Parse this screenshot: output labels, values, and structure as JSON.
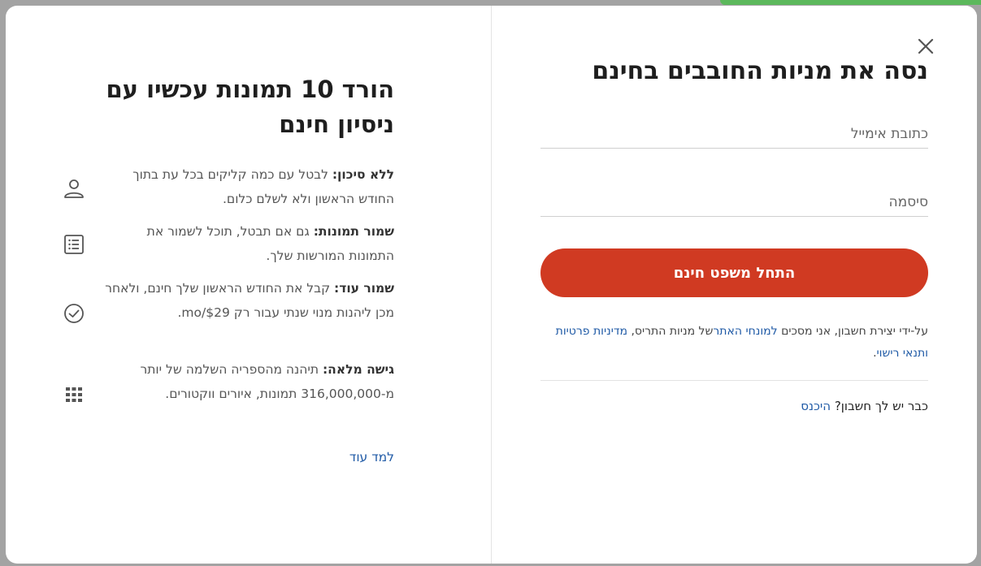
{
  "form": {
    "title": "נסה את מניות החובבים בחינם",
    "email_placeholder": "כתובת אימייל",
    "password_placeholder": "סיסמה",
    "submit_label": "התחל משפט חינם",
    "terms_prefix": "על-ידי יצירת חשבון, אני מסכים ",
    "terms_link": "למונחי האתר",
    "terms_middle": "של מניות התריס, ",
    "privacy_link": "מדיניות פרטיות ותנאי רישוי",
    "terms_suffix": ".",
    "signin_prompt": "כבר יש לך חשבון? ",
    "signin_link": "היכנס"
  },
  "info": {
    "title": "הורד 10 תמונות עכשיו עם ניסיון חינם",
    "benefits": [
      {
        "bold": "ללא סיכון:",
        "text": " לבטל עם כמה קליקים בכל עת בתוך החודש הראשון ולא לשלם כלום.",
        "icon": "user-icon"
      },
      {
        "bold": "שמור תמונות:",
        "text": " גם אם תבטל, תוכל לשמור את התמונות המורשות שלך.",
        "icon": "list-icon"
      },
      {
        "bold": "שמור עוד:",
        "text": " קבל את החודש הראשון שלך חינם, ולאחר מכן ליהנות מנוי שנתי עבור רק $29/mo.",
        "icon": "check-circle-icon"
      },
      {
        "bold": "גישה מלאה:",
        "text": " תיהנה מהספריה השלמה של יותר מ-316,000,000 תמונות, איורים ווקטורים.",
        "icon": "grid-icon"
      }
    ],
    "learn_more": "למד עוד"
  }
}
